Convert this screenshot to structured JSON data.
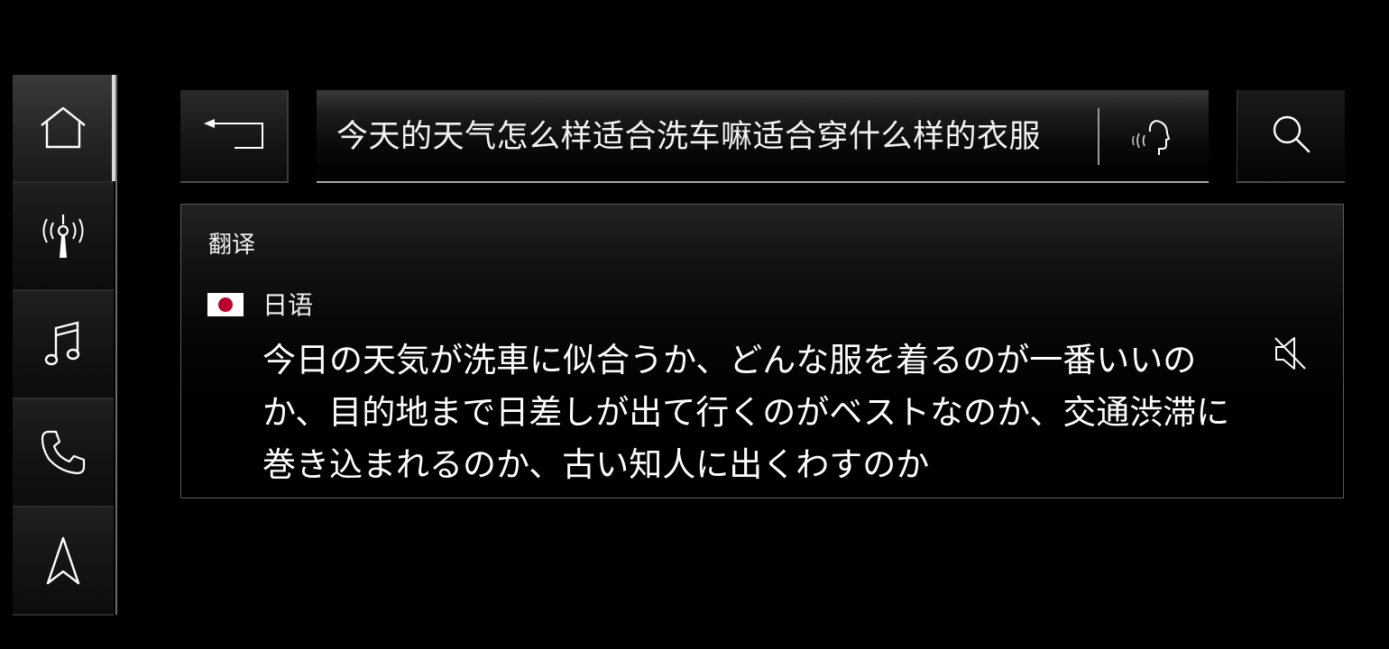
{
  "sidebar": {
    "items": [
      {
        "icon": "home-icon",
        "active": true
      },
      {
        "icon": "radio-antenna-icon",
        "active": false
      },
      {
        "icon": "music-note-icon",
        "active": false
      },
      {
        "icon": "phone-icon",
        "active": false
      },
      {
        "icon": "navigation-arrow-icon",
        "active": false
      }
    ]
  },
  "toolbar": {
    "back_icon": "back-arrow-icon",
    "search_icon": "search-icon",
    "voice_icon": "voice-input-icon"
  },
  "search": {
    "query": "今天的天气怎么样适合洗车嘛适合穿什么样的衣服"
  },
  "translation": {
    "title": "翻译",
    "language": "日语",
    "flag": "japan-flag-icon",
    "text": "今日の天気が洗車に似合うか、どんな服を着るのが一番いいのか、目的地まで日差しが出て行くのがベストなのか、交通渋滞に巻き込まれるのか、古い知人に出くわすのか",
    "speaker_icon": "speaker-mute-icon"
  },
  "colors": {
    "background": "#000000",
    "accent": "#d8d8d8",
    "flag_red": "#bc002d"
  }
}
